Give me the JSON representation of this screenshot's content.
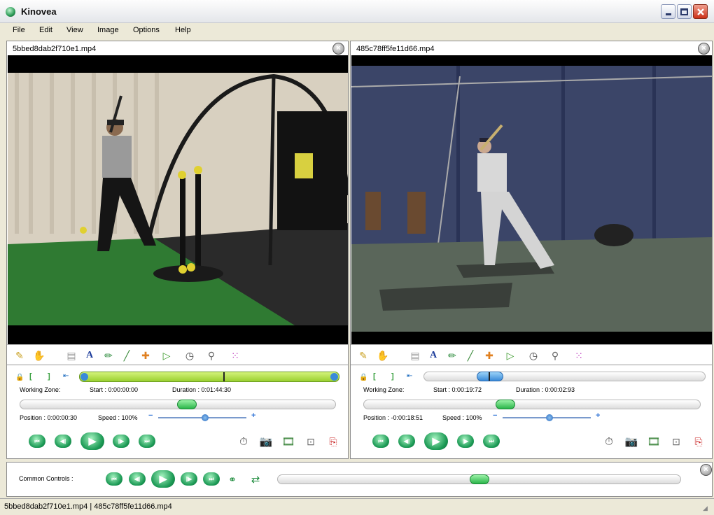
{
  "window": {
    "title": "Kinovea"
  },
  "menu": [
    "File",
    "Edit",
    "View",
    "Image",
    "Options",
    "Help"
  ],
  "players": [
    {
      "filename": "5bbed8dab2f710e1.mp4",
      "working_zone_label": "Working Zone:",
      "start": "Start : 0:00:00:00",
      "duration": "Duration : 0:01:44:30",
      "position": "Position : 0:00:00:30",
      "speed": "Speed : 100%",
      "position_fraction": 0.53,
      "speed_fraction": 0.5
    },
    {
      "filename": "485c78ff5fe11d66.mp4",
      "working_zone_label": "Working Zone:",
      "start": "Start : 0:00:19:72",
      "duration": "Duration : 0:00:02:93",
      "position": "Position : -0:00:18:51",
      "speed": "Speed : 100%",
      "position_fraction": 0.42,
      "speed_fraction": 0.5
    }
  ],
  "common": {
    "label": "Common Controls :",
    "sync_fraction": 0.5
  },
  "status": {
    "text": "5bbed8dab2f710e1.mp4 | 485c78ff5fe11d66.mp4"
  },
  "colors": {
    "accent_green": "#2bb54a",
    "working_zone_green": "#b8e254",
    "window_bg": "#ece9d8"
  }
}
